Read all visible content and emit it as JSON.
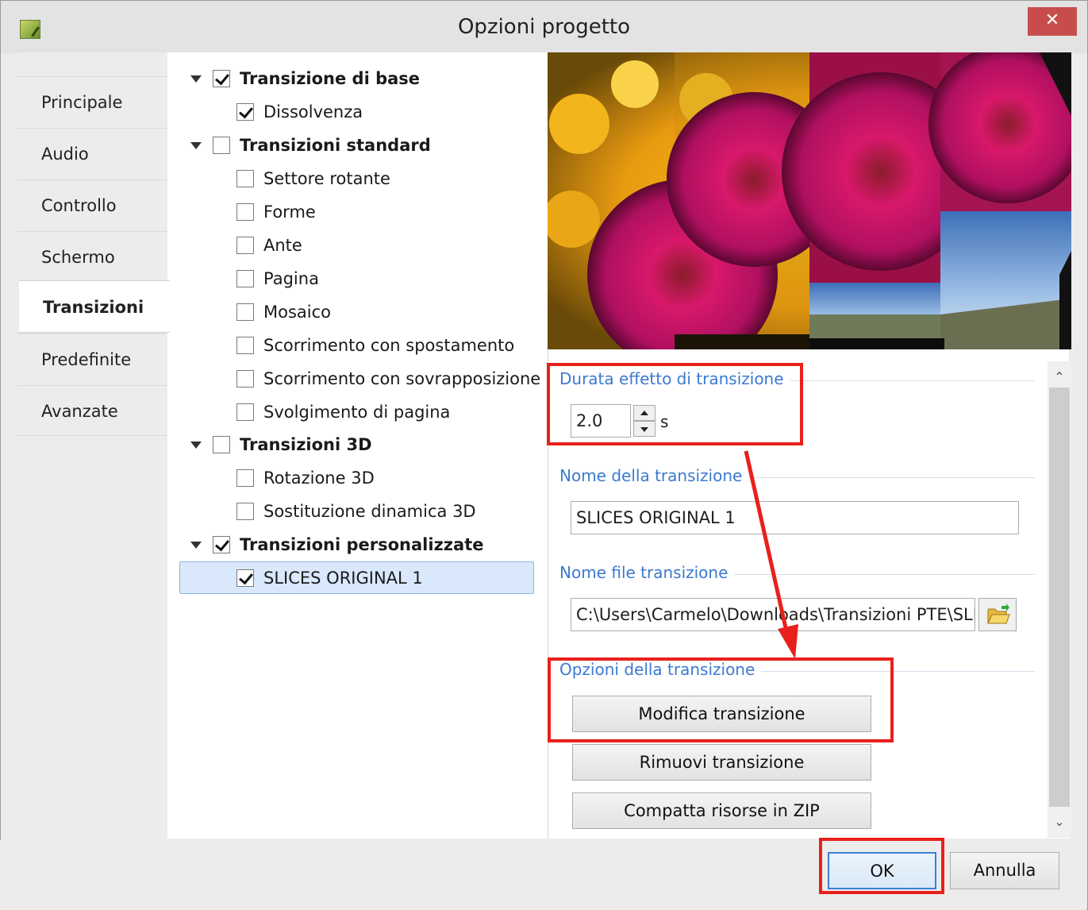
{
  "window": {
    "title": "Opzioni progetto",
    "close_glyph": "✕"
  },
  "nav": {
    "items": [
      {
        "label": "Principale"
      },
      {
        "label": "Audio"
      },
      {
        "label": "Controllo"
      },
      {
        "label": "Schermo"
      },
      {
        "label": "Transizioni",
        "active": true
      },
      {
        "label": "Predefinite"
      },
      {
        "label": "Avanzate"
      }
    ]
  },
  "tree": {
    "items": [
      {
        "label": "Transizione di base",
        "group": true,
        "checked": true
      },
      {
        "label": "Dissolvenza",
        "checked": true
      },
      {
        "label": "Transizioni standard",
        "group": true,
        "checked": false
      },
      {
        "label": "Settore rotante",
        "checked": false
      },
      {
        "label": "Forme",
        "checked": false
      },
      {
        "label": "Ante",
        "checked": false
      },
      {
        "label": "Pagina",
        "checked": false
      },
      {
        "label": "Mosaico",
        "checked": false
      },
      {
        "label": "Scorrimento con spostamento",
        "checked": false
      },
      {
        "label": "Scorrimento con sovrapposizione",
        "checked": false
      },
      {
        "label": "Svolgimento di pagina",
        "checked": false
      },
      {
        "label": "Transizioni 3D",
        "group": true,
        "checked": false
      },
      {
        "label": "Rotazione 3D",
        "checked": false
      },
      {
        "label": "Sostituzione dinamica 3D",
        "checked": false
      },
      {
        "label": "Transizioni personalizzate",
        "group": true,
        "checked": true
      },
      {
        "label": "SLICES ORIGINAL 1",
        "checked": true,
        "selected": true
      }
    ]
  },
  "duration": {
    "title": "Durata effetto di transizione",
    "value": "2.0",
    "unit": "s"
  },
  "name_section": {
    "title": "Nome della transizione",
    "value": "SLICES ORIGINAL 1"
  },
  "file_section": {
    "title": "Nome file transizione",
    "value": "C:\\Users\\Carmelo\\Downloads\\Transizioni PTE\\SLI"
  },
  "options_section": {
    "title": "Opzioni della transizione",
    "edit_label": "Modifica transizione",
    "remove_label": "Rimuovi transizione",
    "zip_label": "Compatta risorse in ZIP"
  },
  "footer": {
    "ok_label": "OK",
    "cancel_label": "Annulla"
  },
  "colors": {
    "accent_title": "#3b7ad0",
    "highlight_red": "#e8201c",
    "selection": "#d9e8fb",
    "close_button": "#c74d4d"
  }
}
